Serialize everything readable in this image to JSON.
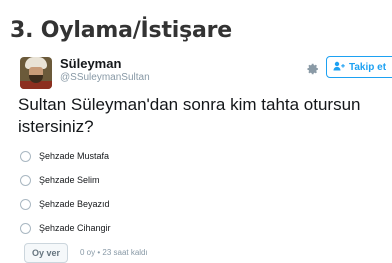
{
  "heading": "3. Oylama/İstişare",
  "tweet": {
    "name": "Süleyman",
    "handle": "@SSuleymanSultan",
    "follow_label": "Takip et",
    "question": "Sultan Süleyman'dan sonra kim tahta otursun istersiniz?",
    "options": [
      "Şehzade Mustafa",
      "Şehzade Selim",
      "Şehzade Beyazıd",
      "Şehzade Cihangir"
    ],
    "vote_label": "Oy ver",
    "meta": "0 oy • 23 saat kaldı"
  },
  "icons": {
    "gear": "gear-icon",
    "follow": "person-plus-icon",
    "avatar": "avatar"
  },
  "colors": {
    "accent": "#1da1f2",
    "text": "#14171a",
    "muted": "#8899a6"
  }
}
